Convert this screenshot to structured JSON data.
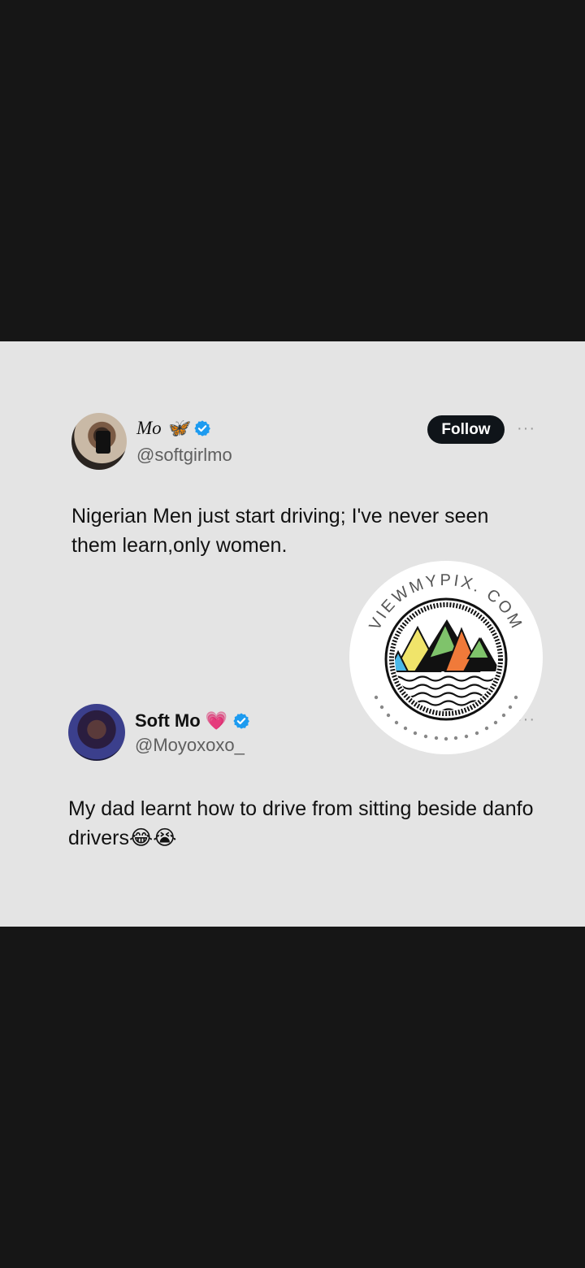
{
  "post": {
    "author_name": "Mo",
    "author_emoji": "🦋",
    "author_handle": "@softgirlmo",
    "follow_label": "Follow",
    "more_label": "···",
    "text": "Nigerian Men just start driving; I've never seen them learn,only women."
  },
  "reply": {
    "author_name": "Soft Mo",
    "author_emoji": "💗",
    "author_handle": "@Moyoxoxo_",
    "more_label": "···",
    "text": "My dad learnt how to drive from sitting beside danfo drivers😂😭"
  },
  "watermark": {
    "text": "VIEWMYPIX. COM"
  },
  "colors": {
    "background": "#161616",
    "card": "#e4e4e4",
    "verified": "#1d9bf0",
    "follow_button": "#0f1419"
  },
  "icons": [
    "verified-badge-icon",
    "more-options-icon"
  ]
}
